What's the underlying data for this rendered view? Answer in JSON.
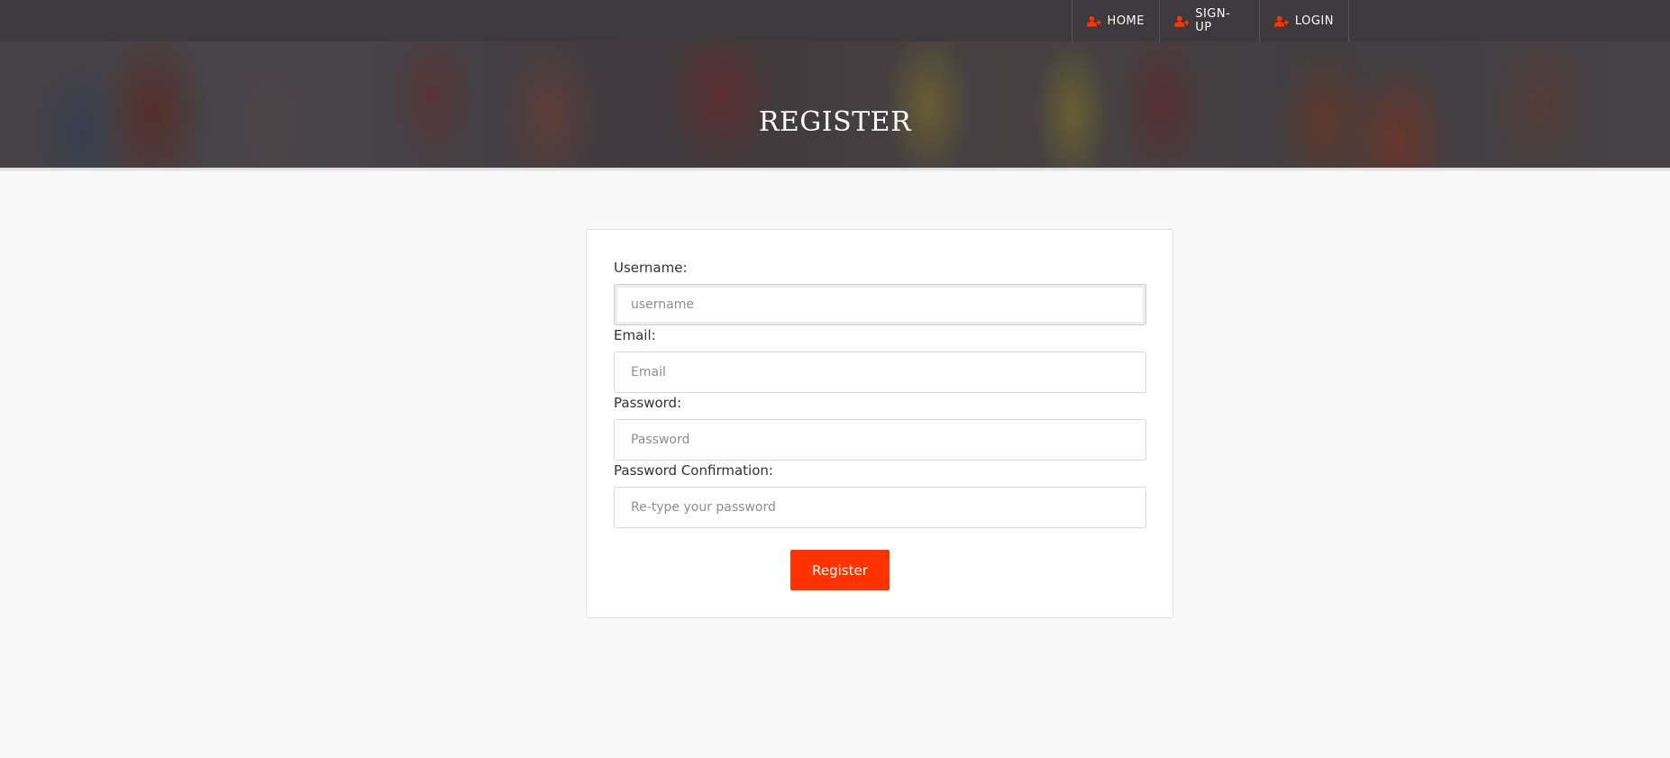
{
  "nav": {
    "items": [
      {
        "label": "HOME",
        "icon": "user-plus-icon"
      },
      {
        "label": "SIGN-UP",
        "icon": "user-plus-icon"
      },
      {
        "label": "LOGIN",
        "icon": "user-plus-icon"
      }
    ],
    "icon_color": "#ff3300"
  },
  "hero": {
    "title": "REGISTER"
  },
  "form": {
    "username": {
      "label": "Username:",
      "placeholder": "username",
      "value": ""
    },
    "email": {
      "label": "Email:",
      "placeholder": "Email",
      "value": ""
    },
    "password": {
      "label": "Password:",
      "placeholder": "Password",
      "value": ""
    },
    "password_confirmation": {
      "label": "Password Confirmation:",
      "placeholder": "Re-type your password",
      "value": ""
    },
    "submit_label": "Register"
  },
  "colors": {
    "accent": "#ff3300",
    "topbar": "#3d393d",
    "background": "#f9f9f9"
  }
}
